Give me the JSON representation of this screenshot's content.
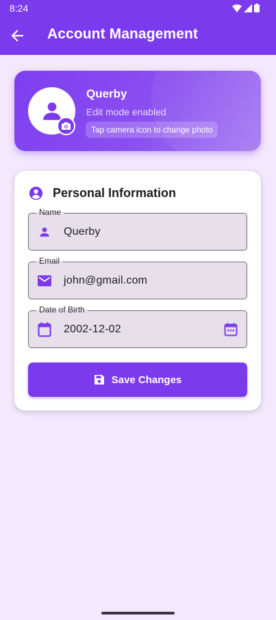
{
  "status_bar": {
    "time": "8:24"
  },
  "app_bar": {
    "title": "Account Management"
  },
  "profile": {
    "name": "Querby",
    "mode": "Edit mode enabled",
    "hint": "Tap camera icon to change photo"
  },
  "personal_info": {
    "title": "Personal Information",
    "fields": [
      {
        "label": "Name",
        "value": "Querby",
        "icon": "person-icon"
      },
      {
        "label": "Email",
        "value": "john@gmail.com",
        "icon": "email-icon"
      },
      {
        "label": "Date of Birth",
        "value": "2002-12-02",
        "icon": "calendar-icon",
        "trailing_icon": "calendar-picker-icon"
      }
    ],
    "save_label": "Save Changes"
  },
  "colors": {
    "primary": "#7c3aed",
    "background": "#f3e8fd",
    "field_fill": "#e7e0ea"
  }
}
